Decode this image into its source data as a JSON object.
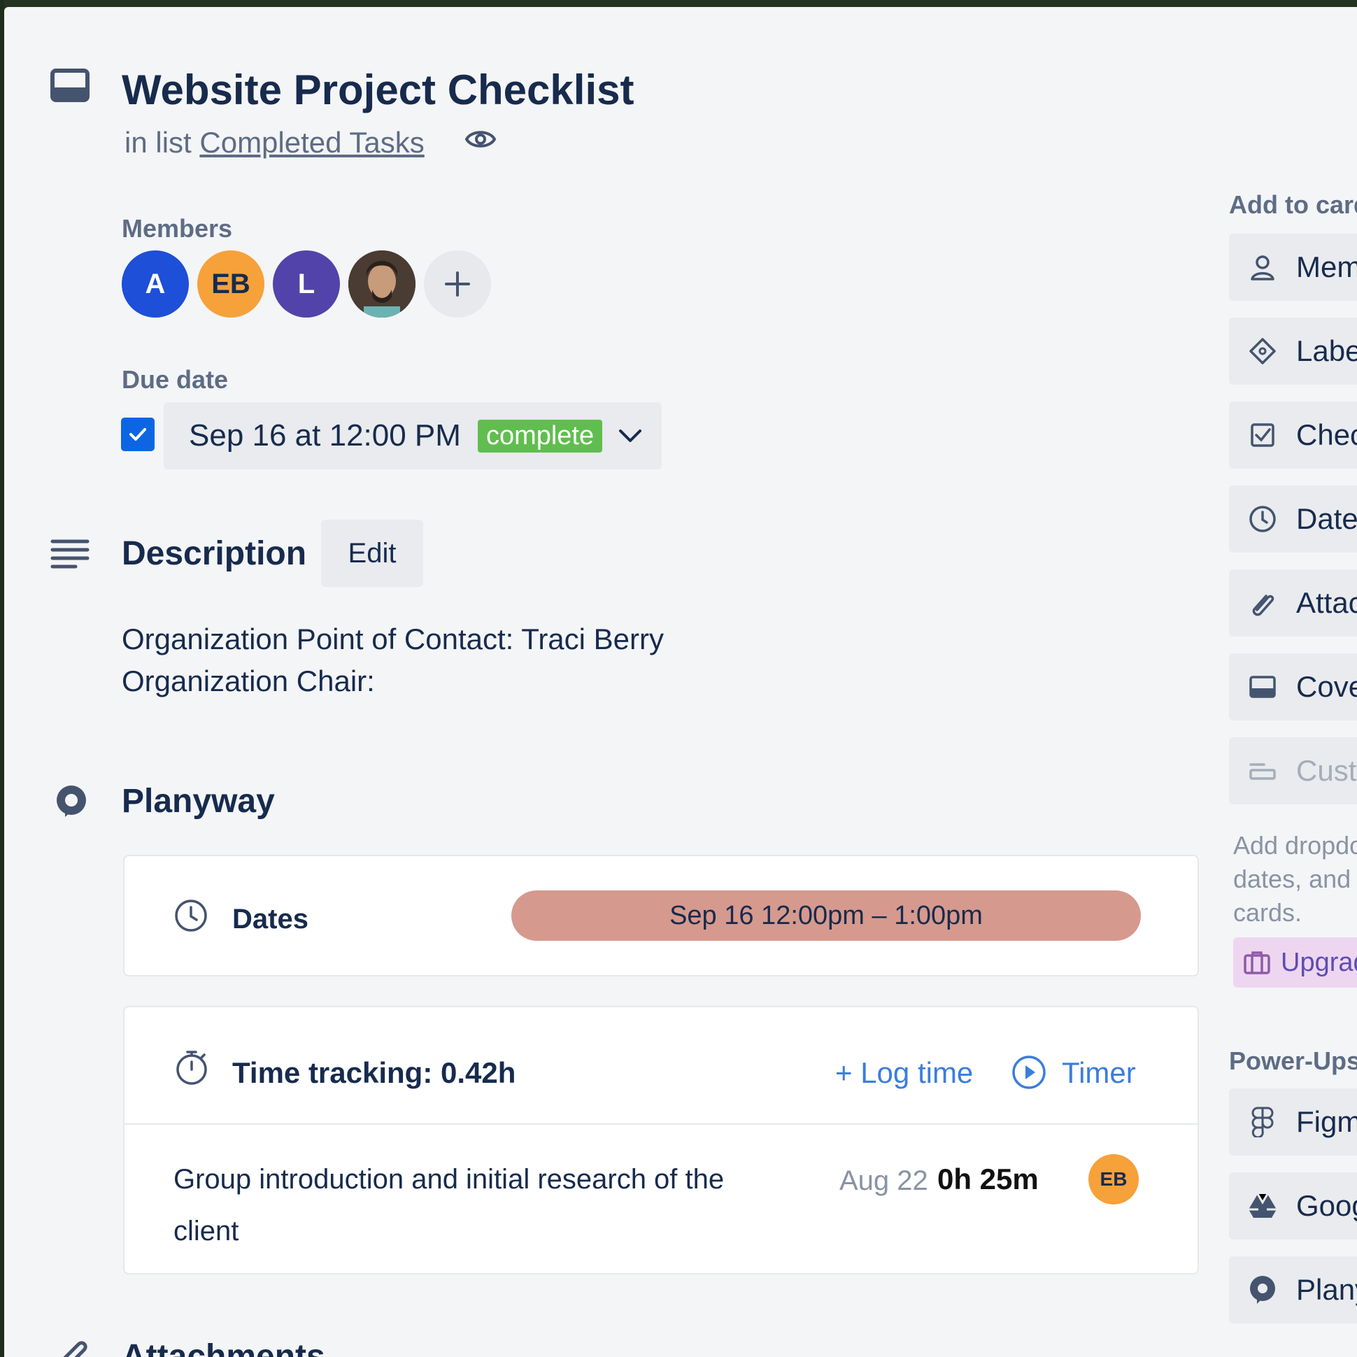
{
  "card": {
    "title": "Website Project Checklist",
    "in_list_prefix": "in list",
    "list_name": "Completed Tasks"
  },
  "members": {
    "label": "Members",
    "avatars": [
      {
        "initials": "A",
        "color": "#1d4fd8"
      },
      {
        "initials": "EB",
        "color": "#f6a13a"
      },
      {
        "initials": "L",
        "color": "#5243aa"
      },
      {
        "initials": "",
        "color": "#3b3028"
      }
    ]
  },
  "due_date": {
    "label": "Due date",
    "value": "Sep 16 at 12:00 PM",
    "status": "complete",
    "checked": true
  },
  "description": {
    "heading": "Description",
    "edit_label": "Edit",
    "lines": [
      "Organization Point of Contact: Traci Berry",
      "Organization Chair:"
    ]
  },
  "planyway": {
    "heading": "Planyway",
    "dates_label": "Dates",
    "dates_value": "Sep 16 12:00pm – 1:00pm",
    "time_tracking_label": "Time tracking: 0.42h",
    "log_time_label": "+ Log time",
    "timer_label": "Timer",
    "entries": [
      {
        "text_line1": "Group introduction and initial research of the",
        "text_line2": "client",
        "date": "Aug 22",
        "duration": "0h 25m",
        "user_initials": "EB"
      }
    ]
  },
  "attachments": {
    "heading": "Attachments"
  },
  "sidebar": {
    "add_to_card_label": "Add to card",
    "add_items": [
      {
        "label": "Members",
        "icon": "person-icon"
      },
      {
        "label": "Labels",
        "icon": "tag-icon"
      },
      {
        "label": "Checklist",
        "icon": "checklist-icon"
      },
      {
        "label": "Dates",
        "icon": "clock-icon"
      },
      {
        "label": "Attachment",
        "icon": "paperclip-icon"
      },
      {
        "label": "Cover",
        "icon": "cover-icon"
      },
      {
        "label": "Custom Fields",
        "icon": "custom-fields-icon",
        "disabled": true
      }
    ],
    "custom_fields_help_lines": [
      "Add dropdowns, text fields,",
      "dates, and more to your",
      "cards."
    ],
    "upgrade_label": "Upgrade",
    "power_ups_label": "Power-Ups",
    "power_ups": [
      {
        "label": "Figma",
        "icon": "figma-icon"
      },
      {
        "label": "Google Drive",
        "icon": "google-drive-icon"
      },
      {
        "label": "Planyway",
        "icon": "planyway-icon"
      }
    ]
  }
}
